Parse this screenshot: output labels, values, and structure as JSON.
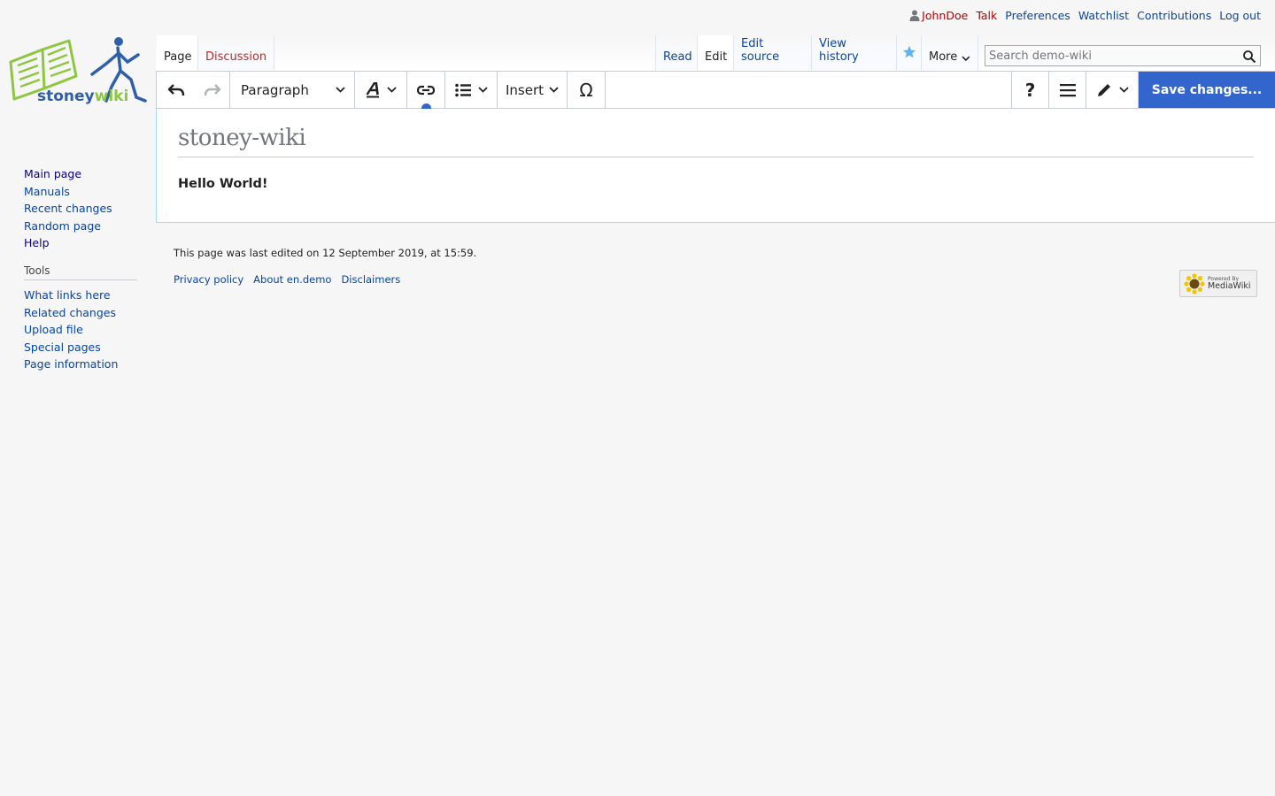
{
  "personal": {
    "user": "JohnDoe",
    "talk": "Talk",
    "preferences": "Preferences",
    "watchlist": "Watchlist",
    "contributions": "Contributions",
    "logout": "Log out"
  },
  "logo": {
    "word1": "stoney",
    "word2": "wiki"
  },
  "tabs": {
    "page": "Page",
    "discussion": "Discussion",
    "read": "Read",
    "edit": "Edit",
    "edit_source": "Edit source",
    "view_history": "View history",
    "more": "More"
  },
  "search": {
    "placeholder": "Search demo-wiki"
  },
  "toolbar": {
    "paragraph": "Paragraph",
    "insert": "Insert",
    "special_char": "Ω",
    "help": "?",
    "save": "Save changes..."
  },
  "content": {
    "title": "stoney-wiki",
    "body": "Hello World!"
  },
  "nav": {
    "items": [
      "Main page",
      "Manuals",
      "Recent changes",
      "Random page",
      "Help"
    ]
  },
  "tools": {
    "heading": "Tools",
    "items": [
      "What links here",
      "Related changes",
      "Upload file",
      "Special pages",
      "Page information"
    ]
  },
  "footer": {
    "last_modified": "This page was last edited on 12 September 2019, at 15:59.",
    "links": [
      "Privacy policy",
      "About en.demo",
      "Disclaimers"
    ],
    "powered_small": "Powered By",
    "powered_big": "MediaWiki"
  },
  "colors": {
    "link": "#0645ad",
    "new_link": "#ba0000",
    "accent": "#3366cc",
    "logo_green": "#8dc63f",
    "logo_blue": "#2e5fa8"
  }
}
